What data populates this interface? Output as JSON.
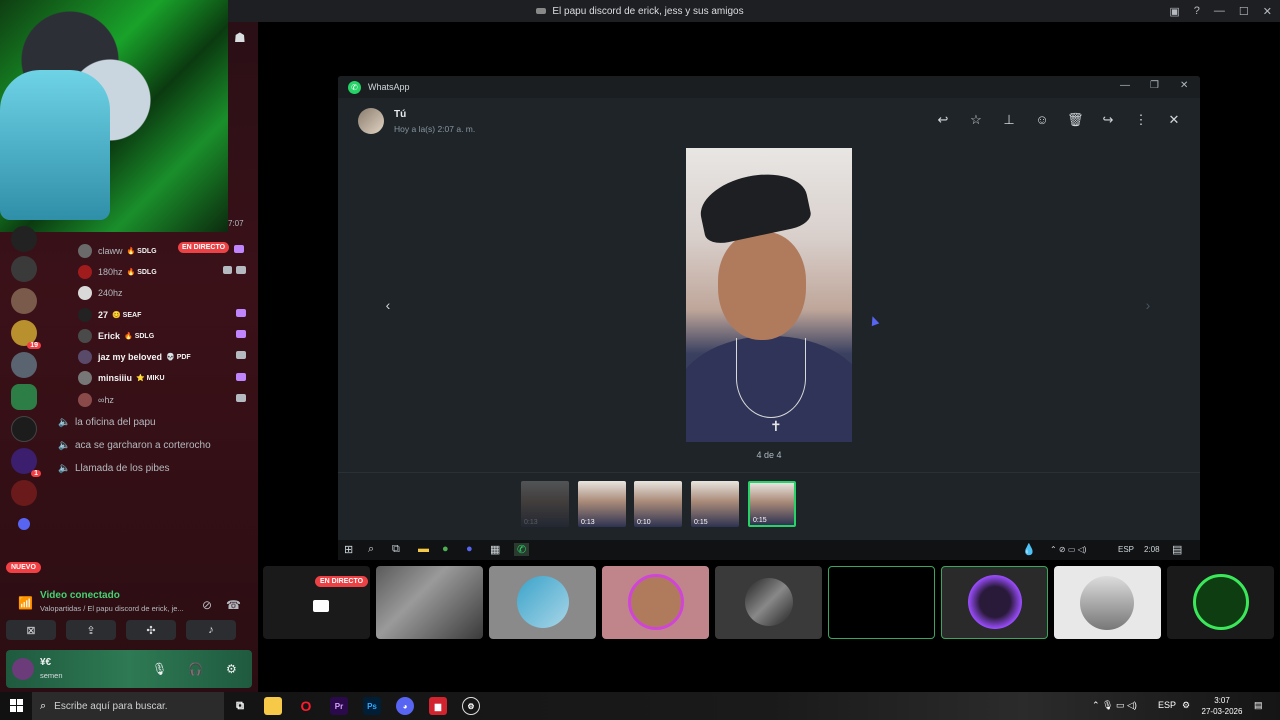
{
  "discord": {
    "window_title": "El papu discord de erick, jess y sus amigos",
    "stream_timer": "7:07",
    "live_badge": "EN DIRECTO",
    "new_badge": "NUEVO",
    "server_badges": [
      "19",
      "1"
    ],
    "users": [
      {
        "name": "claww",
        "tag": "🔥 SDLG",
        "live": true
      },
      {
        "name": "180hz",
        "tag": "🔥 SDLG",
        "live": false
      },
      {
        "name": "240hz",
        "tag": "",
        "live": false
      },
      {
        "name": "27",
        "tag": "😊 SEAF",
        "live": false
      },
      {
        "name": "Erick",
        "tag": "🔥 SDLG",
        "live": false
      },
      {
        "name": "jaz my beloved",
        "tag": "💀 PDF",
        "live": false
      },
      {
        "name": "minsiiiu",
        "tag": "⭐ MIKU",
        "live": false
      },
      {
        "name": "∞hz",
        "tag": "",
        "live": false
      }
    ],
    "voice_channels": [
      "la oficina del papu",
      "aca se garcharon a corterocho",
      "Llamada de los pibes"
    ],
    "voice_panel": {
      "title": "Video conectado",
      "subtitle": "Valopartidas / El papu discord de erick, je..."
    },
    "user": {
      "name": "¥€",
      "status": "semen"
    }
  },
  "whatsapp": {
    "app_name": "WhatsApp",
    "sender": "Tú",
    "timestamp": "Hoy a la(s) 2:07 a. m.",
    "toolbar": [
      "reply-icon",
      "star-icon",
      "pin-icon",
      "emoji-icon",
      "delete-icon",
      "forward-icon",
      "more-icon",
      "close-icon"
    ],
    "counter": "4 de 4",
    "thumbnails": [
      {
        "duration": "0:13",
        "state": "dim"
      },
      {
        "duration": "0:13",
        "state": "normal"
      },
      {
        "duration": "0:10",
        "state": "normal"
      },
      {
        "duration": "0:15",
        "state": "normal"
      },
      {
        "duration": "0:15",
        "state": "selected"
      }
    ]
  },
  "inner_taskbar": {
    "lang": "ESP",
    "time": "2:08"
  },
  "taskbar": {
    "search_placeholder": "Escribe aquí para buscar.",
    "apps": [
      "Pr",
      "Ps"
    ],
    "lang": "ESP",
    "time": "3:07",
    "date": "27-03-2026"
  },
  "colors": {
    "discord_green": "#43d373",
    "live_red": "#ed4245",
    "whatsapp_green": "#25d366"
  }
}
